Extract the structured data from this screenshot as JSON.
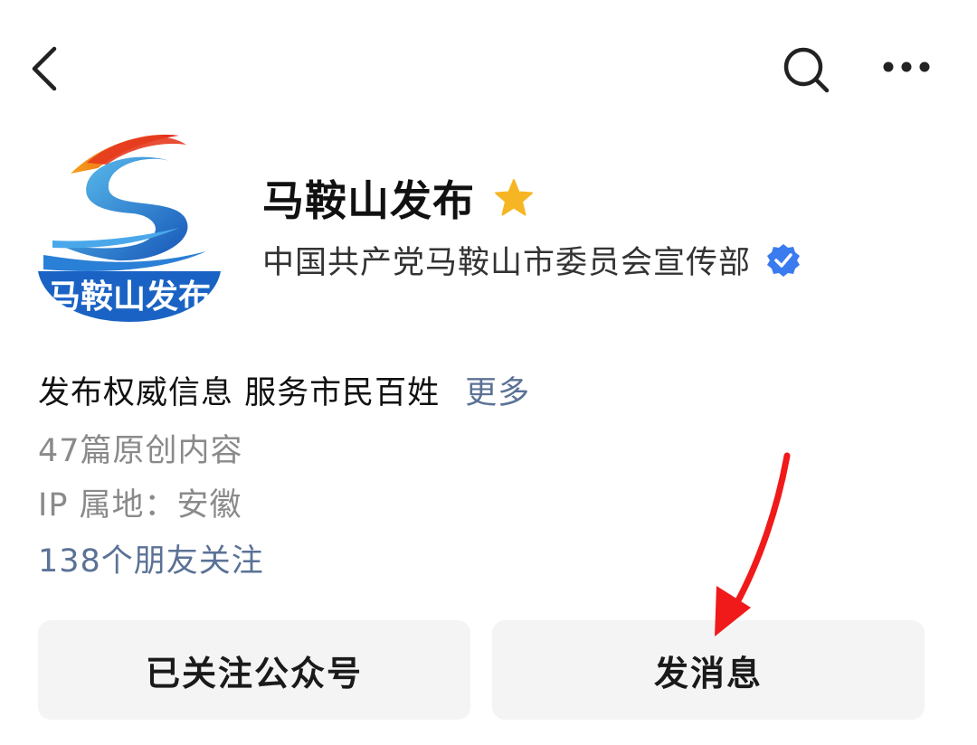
{
  "header": {
    "back_icon": "chevron-left-icon",
    "search_icon": "search-icon",
    "more_icon": "more-horizontal-icon"
  },
  "profile": {
    "logo_text": "马鞍山发布",
    "name": "马鞍山发布",
    "star_icon": "star-icon",
    "organization": "中国共产党马鞍山市委员会宣传部",
    "verified_icon": "verified-badge-icon",
    "description": "发布权威信息 服务市民百姓",
    "more_label": "更多",
    "articles": "47篇原创内容",
    "ip_location": "IP 属地：安徽",
    "friends_following": "138个朋友关注"
  },
  "actions": {
    "follow_label": "已关注公众号",
    "message_label": "发消息"
  },
  "colors": {
    "accent_link": "#5b7296",
    "star": "#f6b623",
    "verified": "#3a7bf0",
    "arrow": "#f01a1a",
    "button_bg": "#f4f4f4"
  }
}
